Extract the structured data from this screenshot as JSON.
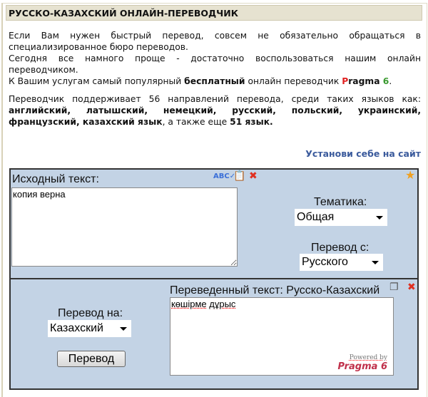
{
  "header": {
    "title": "РУССКО-КАЗАХСКИЙ ОНЛАЙН-ПЕРЕВОДЧИК"
  },
  "intro": {
    "p1": "Если Вам нужен быстрый перевод, совсем не обязательно обращаться в специализированное бюро переводов.",
    "p2": "Сегодня все намного проще - достаточно воспользоваться нашим онлайн переводчиком.",
    "p3_pre": "К Вашим услугам самый популярный ",
    "p3_bold": "бесплатный",
    "p3_mid": " онлайн переводчик ",
    "brand_p": "P",
    "brand_rest": "ragma",
    "brand_num": " 6",
    "p3_end": ".",
    "p4": "Переводчик поддерживает 56 направлений перевода, среди таких языков как: ",
    "p4_bold": "английский, латышский, немецкий, русский, польский, украинский, французский, казахский язык",
    "p4_mid": ", а также еще ",
    "p4_bold2": "51 язык."
  },
  "install_link": "Установи себе на сайт",
  "source": {
    "label": "Исходный текст:",
    "value": "копия верна"
  },
  "topic": {
    "label": "Тематика:",
    "value": "Общая"
  },
  "from": {
    "label": "Перевод с:",
    "value": "Русского"
  },
  "to": {
    "label": "Перевод на:",
    "value": "Казахский"
  },
  "translate_button": "Перевод",
  "result": {
    "label": "Переведенный текст: Русско-Казахский",
    "word1": "көшірме",
    "word2": "дұрыс",
    "powered": "Powered by",
    "powered_brand": "Pragma 6"
  },
  "colors": {
    "panel": "#c3d3e5",
    "brand_red": "#e02020",
    "brand_green": "#3a9a30",
    "link": "#3a5a9c"
  }
}
